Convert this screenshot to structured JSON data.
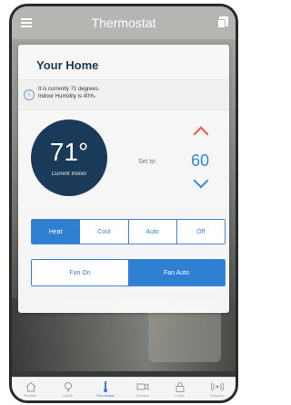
{
  "header": {
    "title": "Thermostat",
    "menu_icon": "hamburger-menu-icon",
    "action_icon": "copy-icon"
  },
  "card": {
    "home_title": "Your Home",
    "info_line1": "It is currently 71 degrees.",
    "info_line2": "Indoor Humidity is 40%.",
    "current_temp": "71°",
    "current_label": "Current Indoor",
    "set_to_label": "Set to:",
    "set_value": "60"
  },
  "modes": [
    {
      "label": "Heat",
      "active": true
    },
    {
      "label": "Cool",
      "active": false
    },
    {
      "label": "Auto",
      "active": false
    },
    {
      "label": "Off",
      "active": false
    }
  ],
  "fan": [
    {
      "label": "Fan On",
      "active": false
    },
    {
      "label": "Fan Auto",
      "active": true
    }
  ],
  "tabs": [
    {
      "label": "Remote",
      "icon": "home-icon",
      "active": false
    },
    {
      "label": "Lights",
      "icon": "lightbulb-icon",
      "active": false
    },
    {
      "label": "Thermostat",
      "icon": "thermometer-icon",
      "active": true
    },
    {
      "label": "Camera",
      "icon": "camera-icon",
      "active": false
    },
    {
      "label": "Locks",
      "icon": "lock-icon",
      "active": false
    },
    {
      "label": "Sensors",
      "icon": "wireless-icon",
      "active": false
    }
  ],
  "colors": {
    "accent": "#2f7fd3",
    "temp_circle": "#1a3a5a",
    "up_arrow": "#e05a4b",
    "down_arrow": "#3b86d4"
  }
}
